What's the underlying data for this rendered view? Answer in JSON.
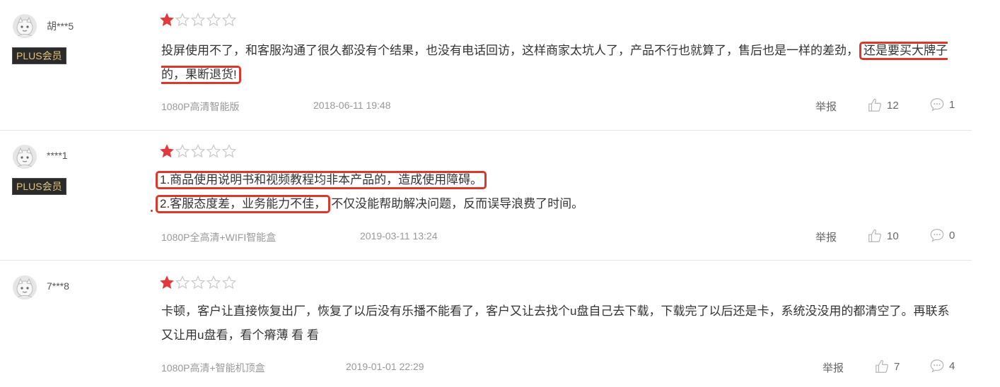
{
  "colors": {
    "accent_red": "#d9382b",
    "star_filled": "#e4393c",
    "star_empty": "#cfcfcf",
    "badge_bg": "#2b2b2b",
    "badge_text": "#e2c47f"
  },
  "reviews": [
    {
      "username": "胡***5",
      "badge": "PLUS会员",
      "rating": 1,
      "content_before": "投屏使用不了，和客服沟通了很久都没有个结果，也没有电话回访，这样商家太坑人了，产品不行也就算了，售后也是一样的差劲，",
      "content_highlight": "还是要买大牌子的，果断退货!",
      "spec": "1080P高清智能版",
      "date": "2018-06-11 19:48",
      "report_label": "举报",
      "likes": "12",
      "replies": "1"
    },
    {
      "username": "****1",
      "badge": "PLUS会员",
      "rating": 1,
      "line1_highlight": "1.商品使用说明书和视频教程均非本产品的，造成使用障碍。",
      "line2_highlight": "2.客服态度差，业务能力不佳，",
      "line2_rest": "不仅没能帮助解决问题，反而误导浪费了时间。",
      "spec": "1080P全高清+WIFI智能盒",
      "date": "2019-03-11 13:24",
      "report_label": "举报",
      "likes": "10",
      "replies": "0"
    },
    {
      "username": "7***8",
      "rating": 1,
      "content": "卡顿，客户让直接恢复出厂，恢复了以后没有乐播不能看了，客户又让去找个u盘自己去下载，下载完了以后还是卡，系统没没用的都清空了。再联系又让用u盘看，看个瘠薄 看 看",
      "spec": "1080P高清+智能机顶盒",
      "date": "2019-01-01 22:29",
      "report_label": "举报",
      "likes": "7",
      "replies": "4"
    }
  ]
}
